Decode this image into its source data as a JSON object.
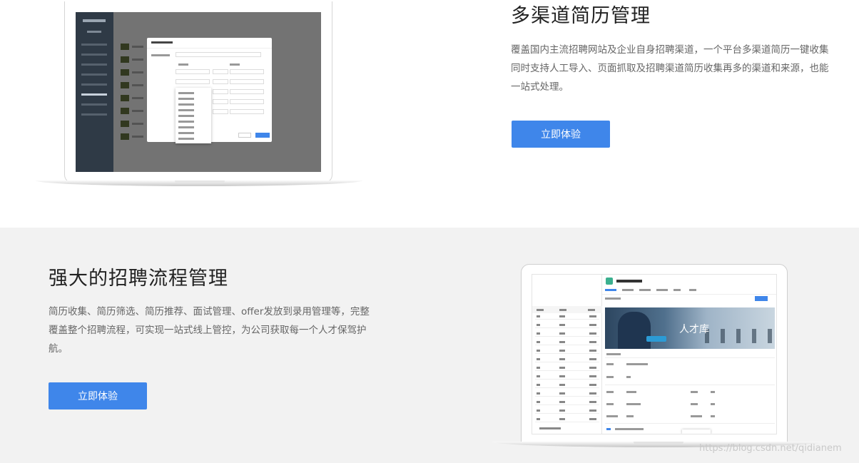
{
  "section1": {
    "title": "多渠道简历管理",
    "description": "覆盖国内主流招聘网站及企业自身招聘渠道，一个平台多渠道简历一键收集同时支持人工导入、页面抓取及招聘渠道简历收集再多的渠道和来源，也能一站式处理。",
    "cta_label": "立即体验"
  },
  "section2": {
    "title": "强大的招聘流程管理",
    "description": "简历收集、简历筛选、简历推荐、面试管理、offer发放到录用管理等，完整覆盖整个招聘流程，可实现一站式线上管控，为公司获取每一个人才保驾护航。",
    "cta_label": "立即体验",
    "screen_banner_text": "人才库"
  },
  "watermark": "https://blog.csdn.net/qidianem",
  "colors": {
    "accent": "#3f86ea",
    "section2_bg": "#f2f2f2"
  }
}
